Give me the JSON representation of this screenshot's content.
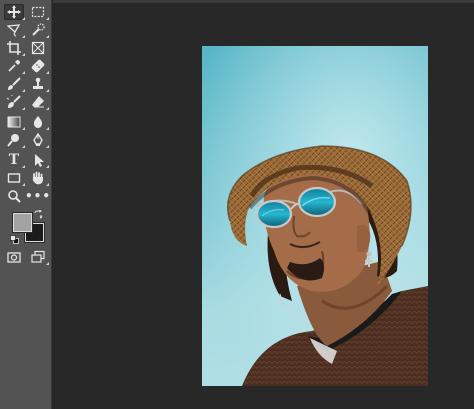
{
  "app": {
    "name": "Image editor",
    "accent": "#535353",
    "canvas_background": "#282828"
  },
  "toolbar": {
    "tools": [
      {
        "name": "move-tool",
        "icon": "move-icon",
        "active": true
      },
      {
        "name": "rectangular-marquee-tool",
        "icon": "marquee-icon"
      },
      {
        "name": "lasso-tool",
        "icon": "lasso-icon"
      },
      {
        "name": "quick-selection-tool",
        "icon": "quick-selection-icon"
      },
      {
        "name": "crop-tool",
        "icon": "crop-icon"
      },
      {
        "name": "frame-tool",
        "icon": "frame-icon"
      },
      {
        "name": "eyedropper-tool",
        "icon": "eyedropper-icon"
      },
      {
        "name": "healing-brush-tool",
        "icon": "bandage-icon"
      },
      {
        "name": "brush-tool",
        "icon": "brush-icon"
      },
      {
        "name": "clone-stamp-tool",
        "icon": "stamp-icon"
      },
      {
        "name": "history-brush-tool",
        "icon": "history-brush-icon"
      },
      {
        "name": "eraser-tool",
        "icon": "eraser-icon"
      },
      {
        "name": "gradient-tool",
        "icon": "gradient-icon"
      },
      {
        "name": "blur-tool",
        "icon": "drop-icon"
      },
      {
        "name": "dodge-tool",
        "icon": "dodge-icon"
      },
      {
        "name": "pen-tool",
        "icon": "pen-icon"
      },
      {
        "name": "type-tool",
        "icon": "type-icon",
        "glyph": "T"
      },
      {
        "name": "path-selection-tool",
        "icon": "arrow-icon"
      },
      {
        "name": "rectangle-tool",
        "icon": "rectangle-icon"
      },
      {
        "name": "hand-tool",
        "icon": "hand-icon"
      },
      {
        "name": "zoom-tool",
        "icon": "zoom-icon"
      },
      {
        "name": "edit-toolbar",
        "icon": "more-icon",
        "glyph": "•••"
      },
      {
        "name": "quick-mask-mode",
        "icon": "quick-mask-icon"
      },
      {
        "name": "screen-mode",
        "icon": "screen-mode-icon"
      }
    ],
    "foreground_color": "#a3a3a3",
    "background_color": "#1b1b1b"
  },
  "document": {
    "description_colors": {
      "sky_top": "#56b5c6",
      "sky_bottom": "#b4e0e6",
      "hat": "#9c6a34",
      "sunglasses": "#1ca6c4",
      "sweater": "#4a2c20"
    }
  }
}
